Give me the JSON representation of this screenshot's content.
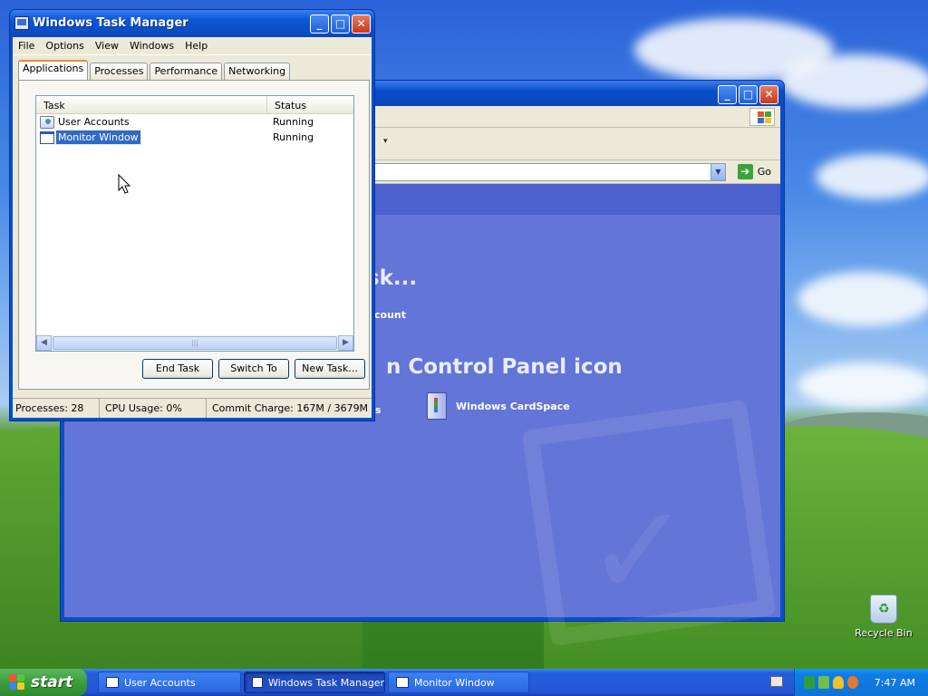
{
  "desktop": {
    "recycle_bin_label": "Recycle Bin"
  },
  "background_window": {
    "heading_task": "isk...",
    "link_account": "count",
    "heading_icon": "n Control Panel icon",
    "truncated_item": "s",
    "cardspace_label": "Windows CardSpace",
    "go_label": "Go"
  },
  "task_manager": {
    "title": "Windows Task Manager",
    "menu": [
      "File",
      "Options",
      "View",
      "Windows",
      "Help"
    ],
    "tabs": [
      "Applications",
      "Processes",
      "Performance",
      "Networking"
    ],
    "active_tab": "Applications",
    "columns": {
      "task": "Task",
      "status": "Status"
    },
    "rows": [
      {
        "task": "User Accounts",
        "status": "Running",
        "icon": "user-accounts-icon",
        "selected": false
      },
      {
        "task": "Monitor Window",
        "status": "Running",
        "icon": "window-icon",
        "selected": true
      }
    ],
    "buttons": {
      "end_task": "End Task",
      "switch_to": "Switch To",
      "new_task": "New Task..."
    },
    "status": {
      "processes": "Processes: 28",
      "cpu": "CPU Usage: 0%",
      "commit": "Commit Charge: 167M / 3679M"
    }
  },
  "taskbar": {
    "start_label": "start",
    "items": [
      {
        "label": "User Accounts",
        "active": false
      },
      {
        "label": "Windows Task Manager",
        "active": true
      },
      {
        "label": "Monitor Window",
        "active": false
      }
    ],
    "clock": "7:47 AM"
  },
  "colors": {
    "titlebar_blue": "#0a4ec8",
    "selection": "#316ac5",
    "start_green": "#3c9e3c",
    "panel_bg": "#ece9d8"
  }
}
